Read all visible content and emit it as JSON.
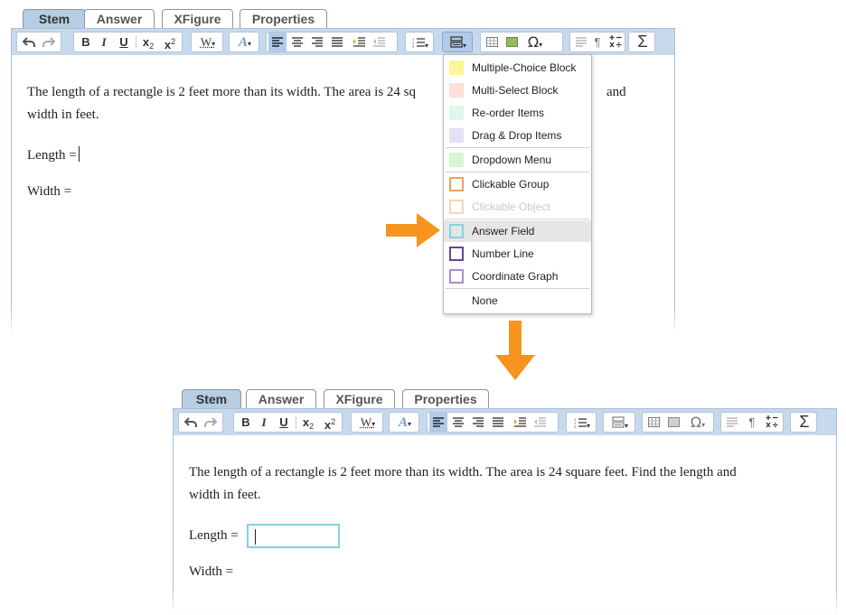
{
  "tabs": [
    "Stem",
    "Answer",
    "XFigure",
    "Properties"
  ],
  "toolbar": {
    "bold": "B",
    "italic": "I",
    "underline": "U",
    "subscript_base": "x",
    "subscript_sub": "2",
    "superscript_base": "x",
    "superscript_sup": "2",
    "word_style": "W",
    "omega": "Ω",
    "pilcrow": "¶",
    "sigma": "Σ"
  },
  "stem_text": {
    "paragraph_line1": "The length of a rectangle is 2 feet more than its width. The area is 24 square feet. Find the length and",
    "paragraph_line2": "width in feet.",
    "paragraph_top_line1": "The length of a rectangle is 2 feet more than its width. The area is 24 sq",
    "paragraph_top_line1_tail": "and",
    "length_label": "Length =",
    "width_label": "Width ="
  },
  "dropdown_menu": {
    "items": [
      {
        "label": "Multiple-Choice Block",
        "color": "#fdf59a"
      },
      {
        "label": "Multi-Select Block",
        "color": "#fde0d6"
      },
      {
        "label": "Re-order Items",
        "color": "#dff6ea"
      },
      {
        "label": "Drag & Drop Items",
        "color": "#e2e1f5"
      },
      {
        "label": "Dropdown Menu",
        "color": "#d8f5d0"
      },
      {
        "label": "Clickable Group",
        "color": "#e8a45a"
      },
      {
        "label": "Clickable Object",
        "color": "#f2d6b8"
      },
      {
        "label": "Answer Field",
        "color": "#86d1df"
      },
      {
        "label": "Number Line",
        "color": "#6b3fa0"
      },
      {
        "label": "Coordinate Graph",
        "color": "#b08cc8"
      },
      {
        "label": "None",
        "color": ""
      }
    ]
  },
  "colors": {
    "arrow": "#f7941d",
    "toolbar_bg": "#c7d9ec",
    "active_tab": "#b6cde3",
    "answer_field_border": "#86d1df"
  }
}
